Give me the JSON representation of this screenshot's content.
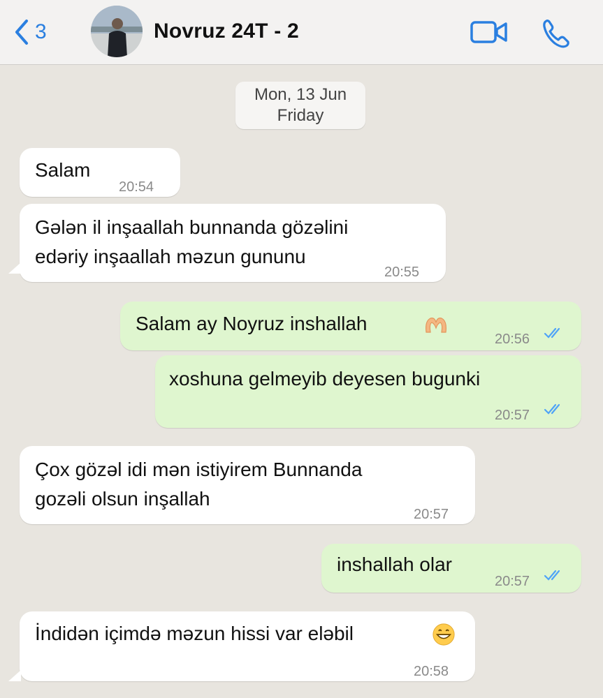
{
  "header": {
    "back_count": "3",
    "contact_name": "Novruz 24T - 2"
  },
  "chat": {
    "date_line1": "Mon, 13 Jun",
    "date_line2": "Friday",
    "messages": [
      {
        "dir": "in",
        "lines": [
          "Salam"
        ],
        "time": "20:54"
      },
      {
        "dir": "in",
        "lines": [
          "Gələn il inşaallah bunnanda gözəlini",
          "edəriy inşaallah məzun gununu"
        ],
        "time": "20:55"
      },
      {
        "dir": "out",
        "lines": [
          "Salam ay Noyruz inshallah"
        ],
        "time": "20:56",
        "emoji": "heart-hands-emoji"
      },
      {
        "dir": "out",
        "lines": [
          "xoshuna gelmeyib deyesen bugunki"
        ],
        "time": "20:57"
      },
      {
        "dir": "in",
        "lines": [
          "Çox gözəl idi mən istiyirem Bunnanda",
          "gozəli olsun inşallah"
        ],
        "time": "20:57"
      },
      {
        "dir": "out",
        "lines": [
          "inshallah olar"
        ],
        "time": "20:57"
      },
      {
        "dir": "in",
        "lines": [
          "İndidən içimdə məzun hissi var eləbil"
        ],
        "time": "20:58",
        "emoji": "grinning-face-emoji"
      }
    ]
  },
  "colors": {
    "accent": "#2a7fe0",
    "incoming_bubble": "#ffffff",
    "outgoing_bubble": "#dff6cf",
    "read_ticks": "#4fa3f7",
    "chat_background": "#e8e5df"
  }
}
